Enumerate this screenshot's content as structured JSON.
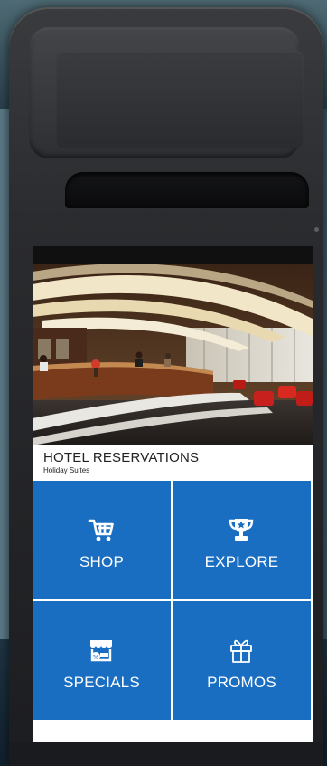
{
  "app": {
    "title": "HOTEL RESERVATIONS",
    "subtitle": "Holiday Suites"
  },
  "tiles": [
    {
      "label": "SHOP",
      "icon": "shopping-cart-icon"
    },
    {
      "label": "EXPLORE",
      "icon": "trophy-icon"
    },
    {
      "label": "SPECIALS",
      "icon": "discount-store-icon"
    },
    {
      "label": "PROMOS",
      "icon": "gift-icon"
    }
  ],
  "colors": {
    "tile": "#1a6ec2",
    "device": "#2a2b2e"
  }
}
